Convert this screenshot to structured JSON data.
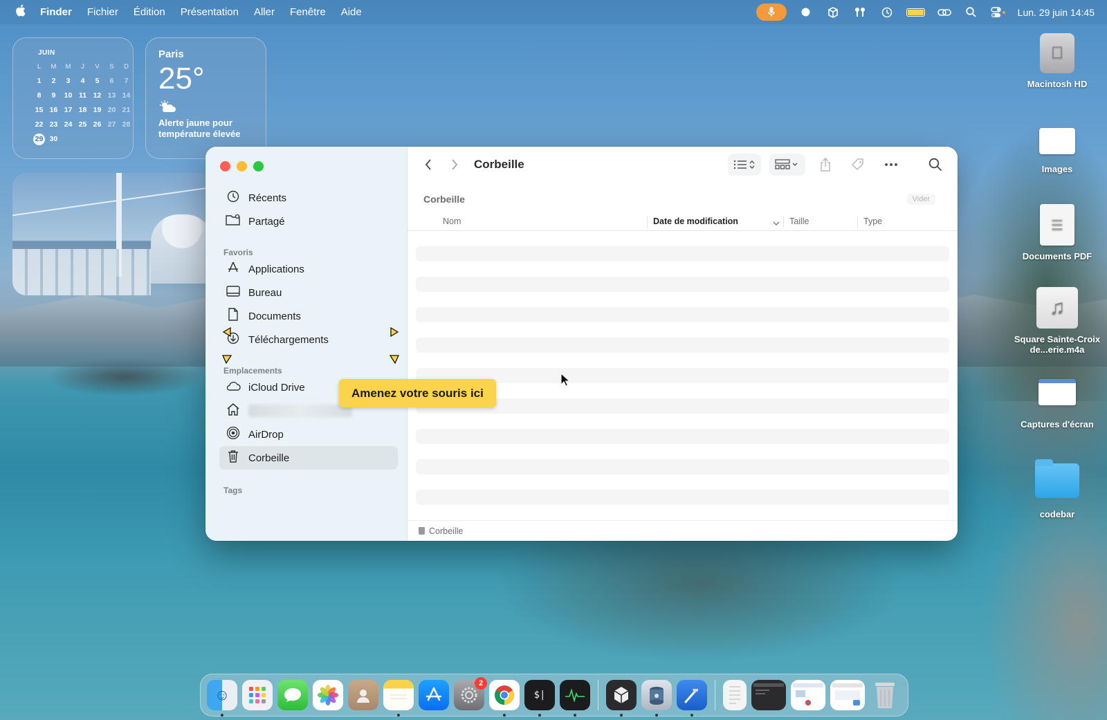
{
  "menubar": {
    "app_name": "Finder",
    "items": [
      "Fichier",
      "Édition",
      "Présentation",
      "Aller",
      "Fenêtre",
      "Aide"
    ],
    "clock": "Lun. 29 juin  14:45",
    "status_icons": [
      "microphone-icon",
      "record-icon",
      "box-icon",
      "airpods-icon",
      "time-machine-icon",
      "battery-icon",
      "link-icon",
      "search-icon",
      "control-center-icon"
    ]
  },
  "calendar_widget": {
    "month": "JUIN",
    "weekday_heads": [
      "L",
      "M",
      "M",
      "J",
      "V",
      "S",
      "D"
    ],
    "weeks": [
      [
        "1",
        "2",
        "3",
        "4",
        "5",
        "6",
        "7"
      ],
      [
        "8",
        "9",
        "10",
        "11",
        "12",
        "13",
        "14"
      ],
      [
        "15",
        "16",
        "17",
        "18",
        "19",
        "20",
        "21"
      ],
      [
        "22",
        "23",
        "24",
        "25",
        "26",
        "27",
        "28"
      ],
      [
        "29",
        "30",
        "",
        "",
        "",
        "",
        ""
      ]
    ],
    "today": "29"
  },
  "weather_widget": {
    "city": "Paris",
    "temperature": "25°",
    "alert": "Alerte jaune pour température élevée"
  },
  "desktop_icons": [
    {
      "label": "Macintosh HD",
      "icon": "hard-drive-icon"
    },
    {
      "label": "Images",
      "icon": "image-file-icon"
    },
    {
      "label": "Documents PDF",
      "icon": "pdf-file-icon"
    },
    {
      "label": "Square Sainte-Croix de...erie.m4a",
      "icon": "audio-file-icon"
    },
    {
      "label": "Captures d'écran",
      "icon": "screenshot-file-icon"
    },
    {
      "label": "codebar",
      "icon": "folder-icon"
    }
  ],
  "finder": {
    "title": "Corbeille",
    "location_label": "Corbeille",
    "empty_button": "Vider",
    "sidebar": {
      "top_items": [
        {
          "label": "Récents",
          "icon": "clock-icon"
        },
        {
          "label": "Partagé",
          "icon": "shared-folder-icon"
        }
      ],
      "favorites_header": "Favoris",
      "favorites": [
        {
          "label": "Applications",
          "icon": "applications-icon"
        },
        {
          "label": "Bureau",
          "icon": "desktop-icon"
        },
        {
          "label": "Documents",
          "icon": "document-icon"
        },
        {
          "label": "Téléchargements",
          "icon": "download-icon"
        }
      ],
      "locations_header": "Emplacements",
      "locations": [
        {
          "label": "iCloud Drive",
          "icon": "cloud-icon"
        },
        {
          "label": "",
          "icon": "home-icon"
        },
        {
          "label": "AirDrop",
          "icon": "airdrop-icon"
        },
        {
          "label": "Corbeille",
          "icon": "trash-icon"
        }
      ],
      "tags_header": "Tags"
    },
    "columns": {
      "name": "Nom",
      "date": "Date de modification",
      "size": "Taille",
      "type": "Type"
    },
    "status_path": "Corbeille"
  },
  "tooltip": {
    "text": "Amenez votre souris ici"
  },
  "dock": {
    "badge_count": "2",
    "apps": [
      "finder-icon",
      "launchpad-icon",
      "messages-icon",
      "photos-icon",
      "contacts-icon",
      "notes-icon",
      "app-store-icon",
      "system-settings-icon",
      "chrome-icon",
      "terminal-icon",
      "activity-monitor-icon",
      "unity-icon",
      "disk-utility-icon",
      "xcode-icon"
    ],
    "recent": [
      "document-thumbnail-icon",
      "terminal-window-thumbnail-icon",
      "chrome-window-thumbnail-icon",
      "preview-window-thumbnail-icon",
      "dock-trash-icon"
    ]
  },
  "colors": {
    "accent_tooltip": "#fbd44b",
    "close": "#fe5f57",
    "minimize": "#febc2e",
    "maximize": "#28c840",
    "mic_pill": "#f29a3c"
  }
}
